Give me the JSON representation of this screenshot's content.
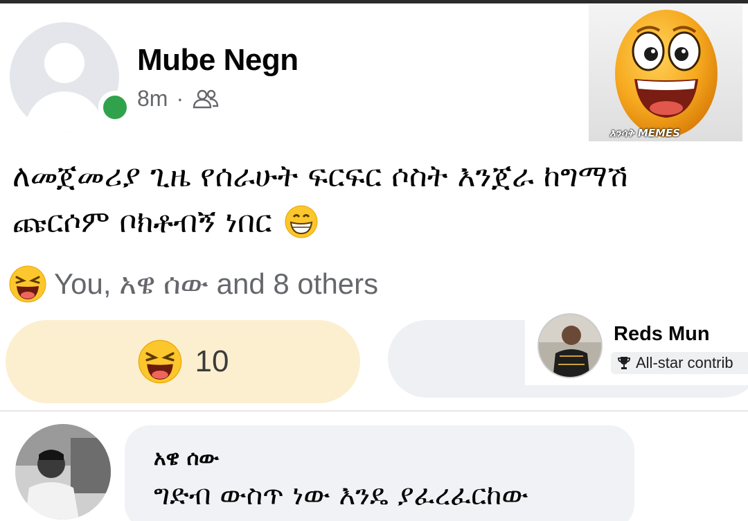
{
  "post": {
    "author": "Mube Negn",
    "time": "8m",
    "separator": "·",
    "audience_icon": "friends-icon",
    "text_line1": "ለመጀመሪያ ጊዜ የሰራሁት ፍርፍር ሶስት እንጀራ ከግማሽ",
    "text_line2": "ጩርሶም ቦክቶብኝ ነበር",
    "text_emoji": "grinning-face-icon",
    "online_status_color": "#31a24c"
  },
  "meme_logo": {
    "caption": "እንሳቅ MEMES",
    "icon": "laughing-egg-icon"
  },
  "reactions": {
    "summary": "You, አዌ ሰው and 8 others",
    "icon": "haha-reaction-icon",
    "button_count": "10",
    "accent": "#fcefcf"
  },
  "overlay_commenter": {
    "name": "Reds Mun",
    "badge": "All-star contrib",
    "badge_icon": "trophy-icon"
  },
  "comment": {
    "author": "አዌ ሰው",
    "text": "ግድብ ውስጥ ነው እንዴ ያፈረፈርከው"
  }
}
